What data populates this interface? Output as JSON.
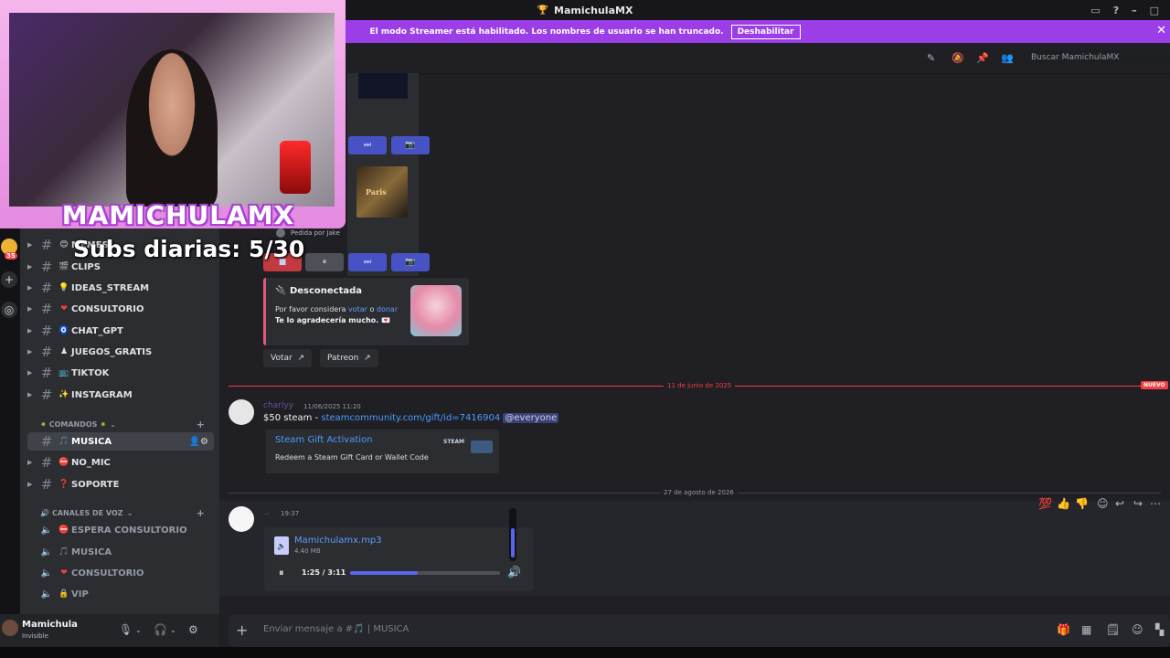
{
  "titlebar": {
    "title": "MamichulaMX"
  },
  "banner": {
    "text": "El modo Streamer está habilitado. Los nombres de usuario se han truncado.",
    "button": "Deshabilitar"
  },
  "rail": {
    "badge": "35"
  },
  "sidebar": {
    "channels": [
      {
        "emoji": "😊",
        "name": "MEMES",
        "active": false
      },
      {
        "emoji": "🎬",
        "name": "CLIPS",
        "active": false
      },
      {
        "emoji": "💡",
        "name": "IDEAS_STREAM",
        "active": false
      },
      {
        "emoji": "❤",
        "name": "CONSULTORIO",
        "active": false
      },
      {
        "emoji": "🧿",
        "name": "CHAT_GPT",
        "active": false
      },
      {
        "emoji": "♟",
        "name": "JUEGOS_GRATIS",
        "active": false
      },
      {
        "emoji": "📺",
        "name": "TIKTOK",
        "active": false
      },
      {
        "emoji": "✨",
        "name": "INSTAGRAM",
        "active": false
      }
    ],
    "category_commands": "COMANDOS",
    "command_channels": [
      {
        "emoji": "🎵",
        "name": "MUSICA",
        "active": true
      },
      {
        "emoji": "⛔",
        "name": "NO_MIC",
        "active": false
      },
      {
        "emoji": "❓",
        "name": "SOPORTE",
        "active": false
      }
    ],
    "category_voice": "CANALES DE VOZ",
    "voice_channels": [
      {
        "emoji": "⛔",
        "name": "ESPERA CONSULTORIO"
      },
      {
        "emoji": "🎵",
        "name": "MUSICA"
      },
      {
        "emoji": "❤",
        "name": "CONSULTORIO"
      },
      {
        "emoji": "🔒",
        "name": "VIP"
      }
    ]
  },
  "user": {
    "name": "Mamichula",
    "status": "Invisible"
  },
  "header": {
    "search_placeholder": "Buscar MamichulaMX"
  },
  "music": {
    "album_text": "Paris",
    "requested_by": "Pedida por Jake",
    "embed": {
      "title": "Desconectada",
      "line1_prefix": "Por favor considera ",
      "vote_link": "votar",
      "conj": " o ",
      "donate_link": "donar",
      "line2": "Te lo agradecería mucho."
    },
    "buttons": {
      "vote": "Votar",
      "patreon": "Patreon"
    }
  },
  "divider_new": {
    "date": "11 de junio de 2025",
    "tag": "NUEVO"
  },
  "message1": {
    "author": "charlyy",
    "time": "11/06/2025 11:20",
    "text_prefix": "$50 steam - ",
    "link": "steamcommunity.com/gift/id=7416904",
    "mention": "@everyone",
    "embed_title": "Steam Gift Activation",
    "embed_desc": "Redeem a Steam Gift Card or Wallet Code",
    "embed_logo": "STEAM"
  },
  "divider2": {
    "date": "27 de agosto de 2026"
  },
  "message2": {
    "author": "...",
    "time": "19:37",
    "file_name": "Mamichulamx.mp3",
    "file_size": "4.40 MB",
    "play_time": "1:25 / 3:11",
    "progress": 0.45,
    "volume": 0.65
  },
  "composer": {
    "placeholder": "Enviar mensaje a #🎵 | MUSICA"
  },
  "overlay": {
    "streamer_name": "MAMICHULAMX",
    "subs": "Subs diarias: 5/30"
  }
}
